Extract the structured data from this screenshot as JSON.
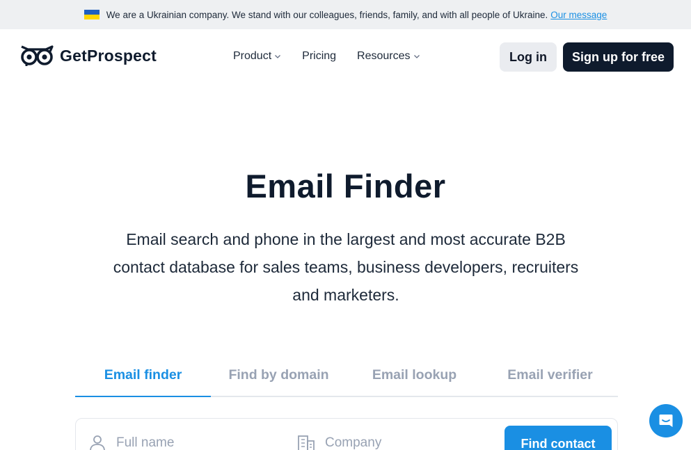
{
  "banner": {
    "text": "We are a Ukrainian company. We stand with our colleagues, friends, family, and with all people of Ukraine.",
    "link": "Our message",
    "flag_colors": [
      "#1f5fbf",
      "#ffd500"
    ]
  },
  "header": {
    "brand": "GetProspect",
    "nav": [
      {
        "label": "Product",
        "has_dropdown": true
      },
      {
        "label": "Pricing",
        "has_dropdown": false
      },
      {
        "label": "Resources",
        "has_dropdown": true
      }
    ],
    "login": "Log in",
    "signup": "Sign up for free"
  },
  "hero": {
    "title": "Email Finder",
    "subtitle": "Email search and phone in the largest and most accurate B2B contact database for sales teams, business developers, recruiters and marketers."
  },
  "tabs": [
    {
      "label": "Email finder",
      "active": true
    },
    {
      "label": "Find by domain",
      "active": false
    },
    {
      "label": "Email lookup",
      "active": false
    },
    {
      "label": "Email verifier",
      "active": false
    }
  ],
  "form": {
    "name_placeholder": "Full name",
    "company_placeholder": "Company",
    "button": "Find contact"
  },
  "colors": {
    "accent": "#1a8fe3",
    "dark": "#0f1b2d"
  }
}
